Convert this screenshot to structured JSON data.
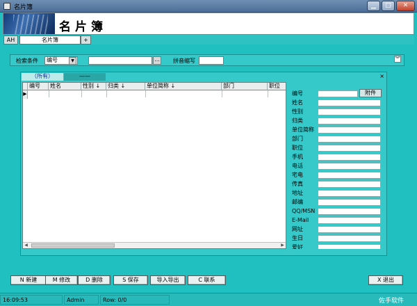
{
  "window": {
    "title": "名片簿"
  },
  "banner": {
    "app_title": "名片簿"
  },
  "doc_tabs": [
    {
      "label": "AH"
    },
    {
      "label": "名片簿"
    },
    {
      "label": "+"
    }
  ],
  "search": {
    "condition_label": "检索条件",
    "field_value": "编号",
    "keyword_value": "",
    "ellipsis_label": "...",
    "pinyin_label": "拼音缩写",
    "pinyin_value": "",
    "collapse_icon": "chevron-double-down-icon"
  },
  "panel": {
    "tabs": [
      {
        "label": "（所有）"
      },
      {
        "label": "——"
      }
    ],
    "close_label": "×"
  },
  "table": {
    "columns": [
      "编号",
      "姓名",
      "性别 ↓",
      "归类 ↓",
      "单位简称 ↓",
      "部门",
      "职位"
    ],
    "rows": []
  },
  "detail": {
    "attach_label": "附件",
    "fields": [
      "编号",
      "姓名",
      "性别",
      "归类",
      "单位简称",
      "部门",
      "职位",
      "手机",
      "电话",
      "宅电",
      "传真",
      "地址",
      "邮编",
      "QQ/MSN",
      "E-Mail",
      "网址",
      "生日",
      "爱好"
    ]
  },
  "buttons": {
    "new": "N 新建",
    "edit": "M 修改",
    "delete": "D 删除",
    "save": "S 保存",
    "import_export": "导入导出",
    "contact": "C 联系",
    "exit": "X 退出"
  },
  "status": {
    "time": "16:09:53",
    "user": "Admin",
    "row": "Row: 0/0",
    "brand": "佐手软件"
  }
}
